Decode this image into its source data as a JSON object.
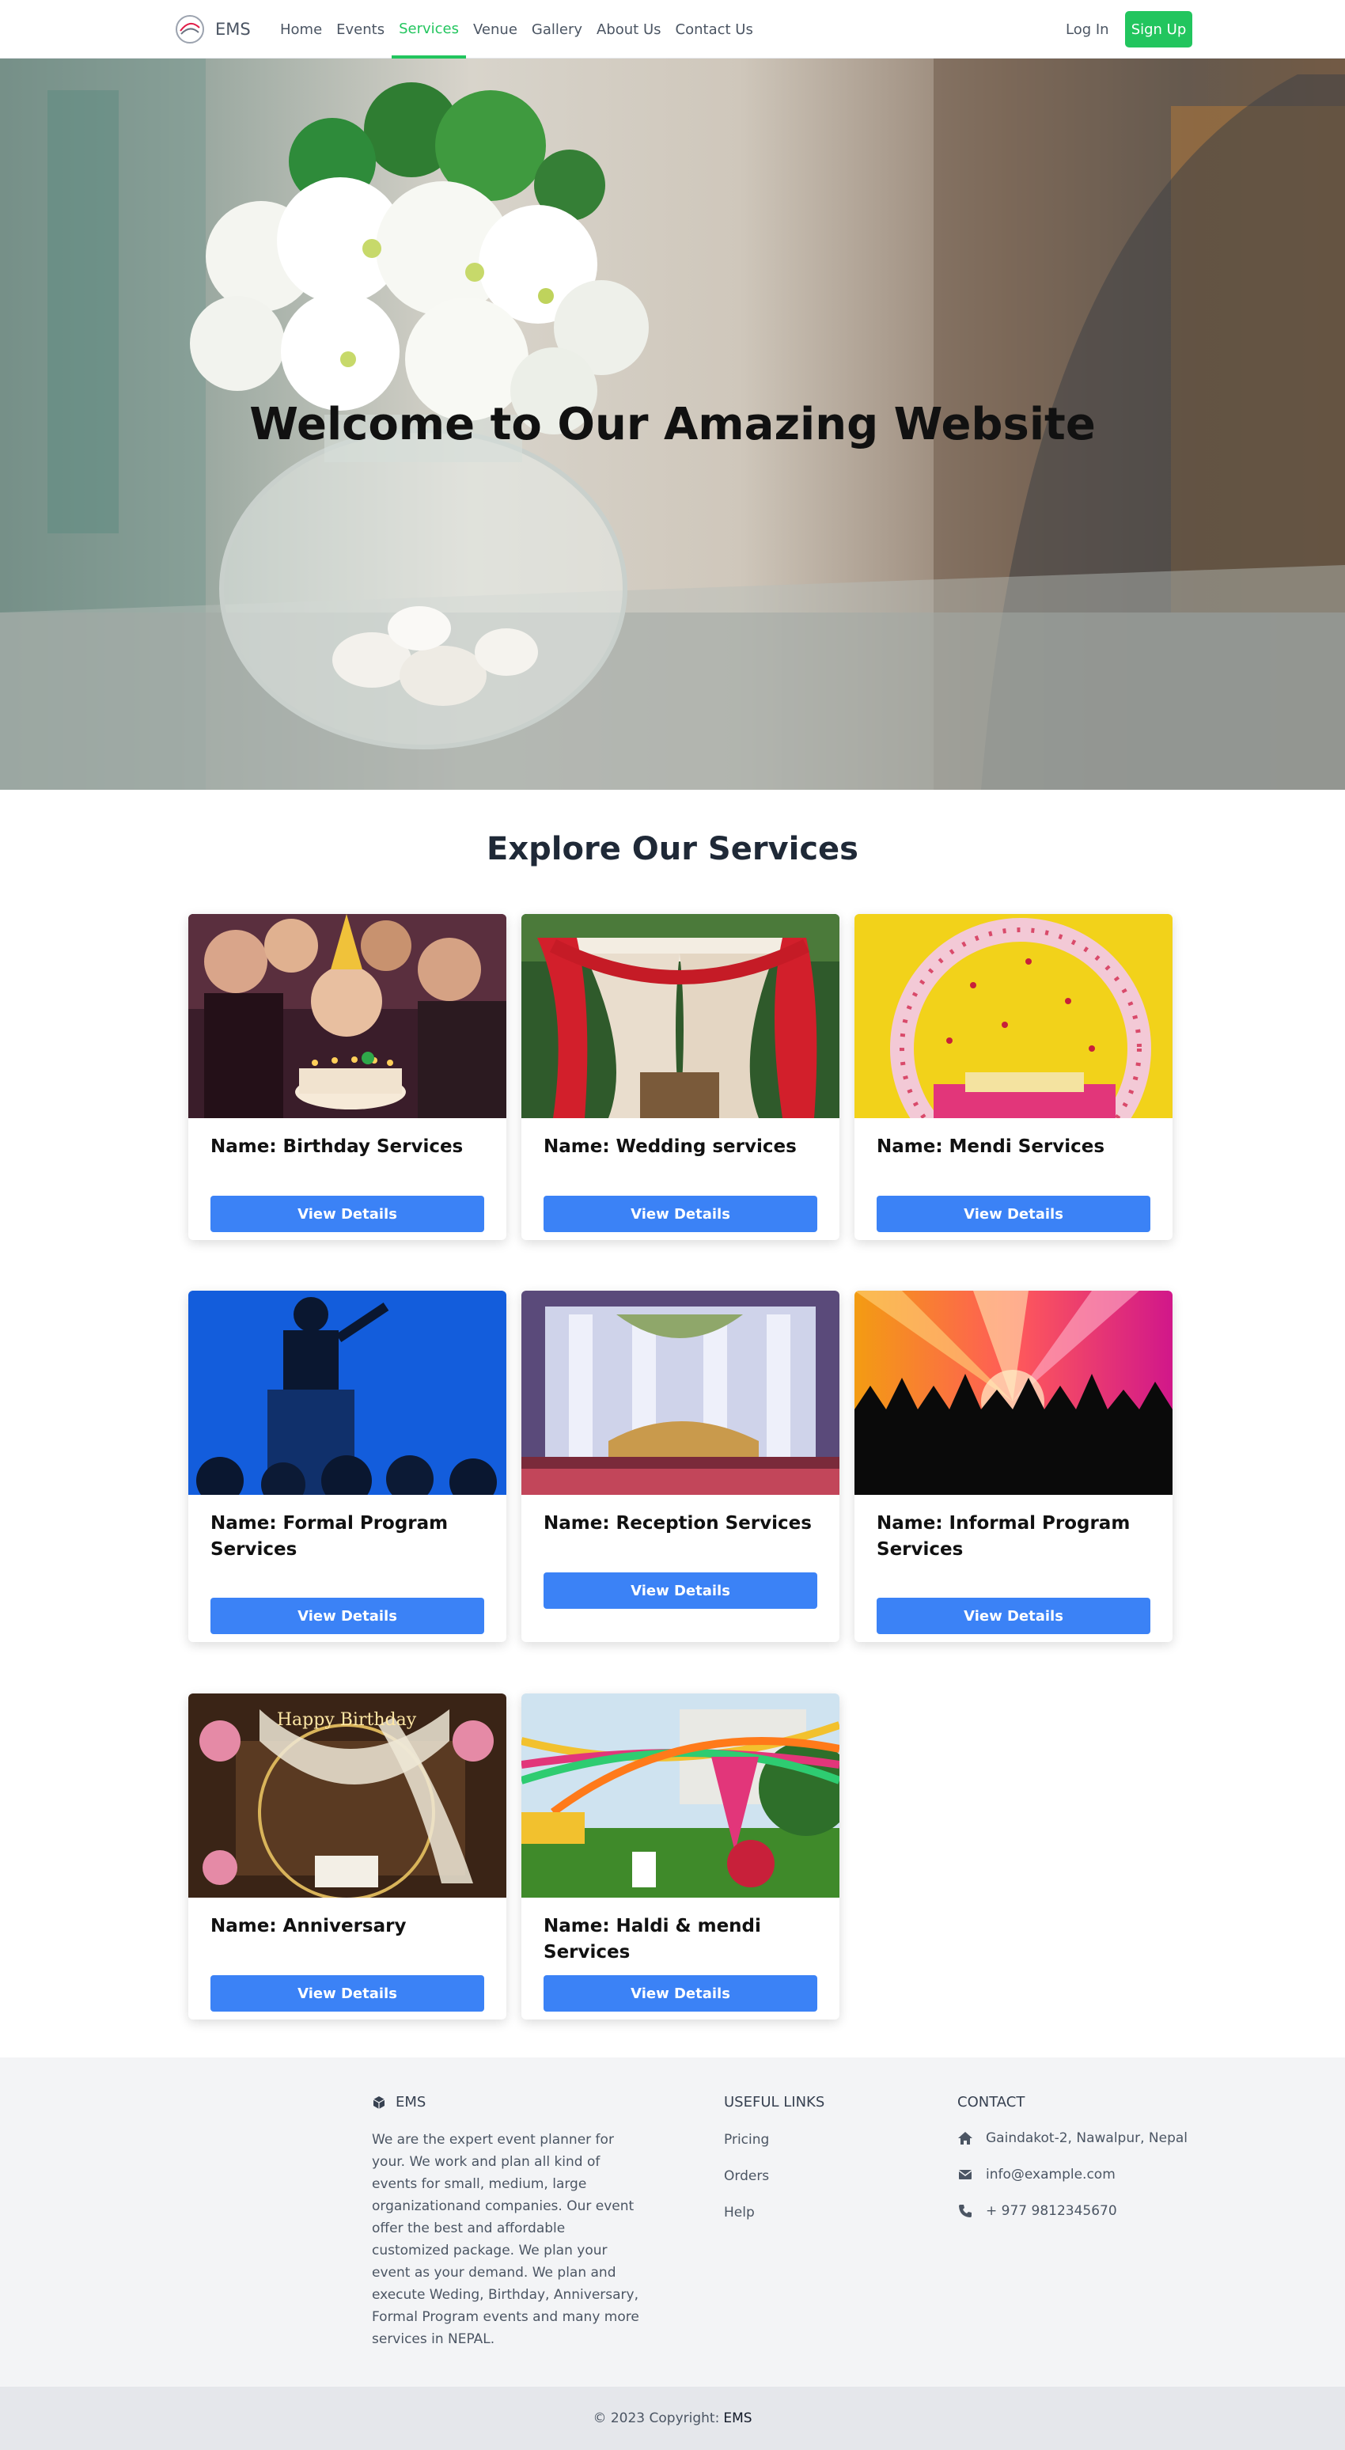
{
  "nav": {
    "brand": "EMS",
    "links": [
      "Home",
      "Events",
      "Services",
      "Venue",
      "Gallery",
      "About Us",
      "Contact Us"
    ],
    "active": "Services",
    "login": "Log In",
    "signup": "Sign Up"
  },
  "hero": {
    "title": "Welcome to Our Amazing Website"
  },
  "services": {
    "title": "Explore Our Services",
    "button_label": "View Details",
    "cards": [
      {
        "name": "Name: Birthday Services",
        "image": "birthday-party-photo"
      },
      {
        "name": "Name: Wedding services",
        "image": "wedding-mandap-photo"
      },
      {
        "name": "Name: Mendi Services",
        "image": "mendi-stage-photo"
      },
      {
        "name": "Name: Formal Program Services",
        "image": "formal-program-photo"
      },
      {
        "name": "Name: Reception Services",
        "image": "reception-stage-photo"
      },
      {
        "name": "Name: Informal Program Services",
        "image": "concert-crowd-photo"
      },
      {
        "name": "Name: Anniversary",
        "image": "anniversary-decor-photo"
      },
      {
        "name": "Name: Haldi & mendi Services",
        "image": "haldi-garden-photo"
      }
    ]
  },
  "footer": {
    "brand": "EMS",
    "about": "We are the expert event planner for your. We work and plan all kind of events for small, medium, large organizationand companies. Our event offer the best and affordable customized package. We plan your event as your demand. We plan and execute Weding, Birthday, Anniversary, Formal Program events and many more services in NEPAL.",
    "links_heading": "USEFUL LINKS",
    "links": [
      "Pricing",
      "Orders",
      "Help"
    ],
    "contact_heading": "CONTACT",
    "contact": {
      "address": "Gaindakot-2, Nawalpur, Nepal",
      "email": "info@example.com",
      "phone": "+ 977 9812345670"
    },
    "copyright_prefix": "© 2023 Copyright:",
    "copyright_brand": "EMS"
  },
  "colors": {
    "accent": "#22c55e",
    "button": "#3b82f6",
    "footer_bg": "#f3f4f6"
  }
}
